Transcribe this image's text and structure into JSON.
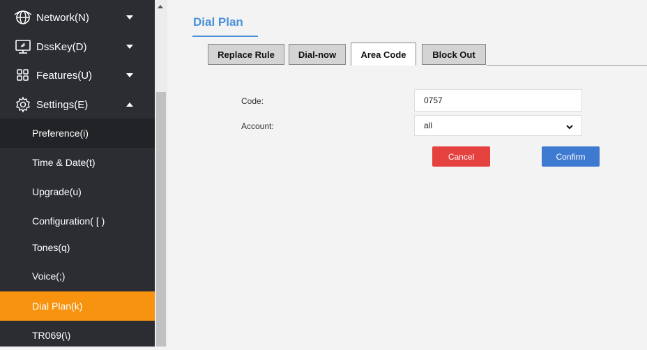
{
  "sidebar": {
    "groups": [
      {
        "label": "Network(N)",
        "icon": "network-icon",
        "expanded": false
      },
      {
        "label": "DssKey(D)",
        "icon": "monitor-icon",
        "expanded": false
      },
      {
        "label": "Features(U)",
        "icon": "grid-icon",
        "expanded": false
      },
      {
        "label": "Settings(E)",
        "icon": "gear-icon",
        "expanded": true
      }
    ],
    "settings_items": [
      "Preference(i)",
      "Time & Date(t)",
      "Upgrade(u)",
      "Configuration( [ )",
      "Tones(q)",
      "Voice(;)",
      "Dial Plan(k)",
      "TR069(\\)"
    ],
    "selected_item": "Dial Plan(k)",
    "colors": {
      "background": "#2b2d33",
      "selected": "#f7930e"
    }
  },
  "main": {
    "title": "Dial Plan",
    "tabs": [
      {
        "label": "Replace Rule",
        "active": false
      },
      {
        "label": "Dial-now",
        "active": false
      },
      {
        "label": "Area Code",
        "active": true
      },
      {
        "label": "Block Out",
        "active": false
      }
    ],
    "form": {
      "code_label": "Code:",
      "code_value": "0757",
      "account_label": "Account:",
      "account_value": "all"
    },
    "buttons": {
      "cancel": "Cancel",
      "confirm": "Confirm"
    },
    "colors": {
      "title": "#4a90d9",
      "cancel": "#e5413f",
      "confirm": "#3f7ad1"
    }
  }
}
